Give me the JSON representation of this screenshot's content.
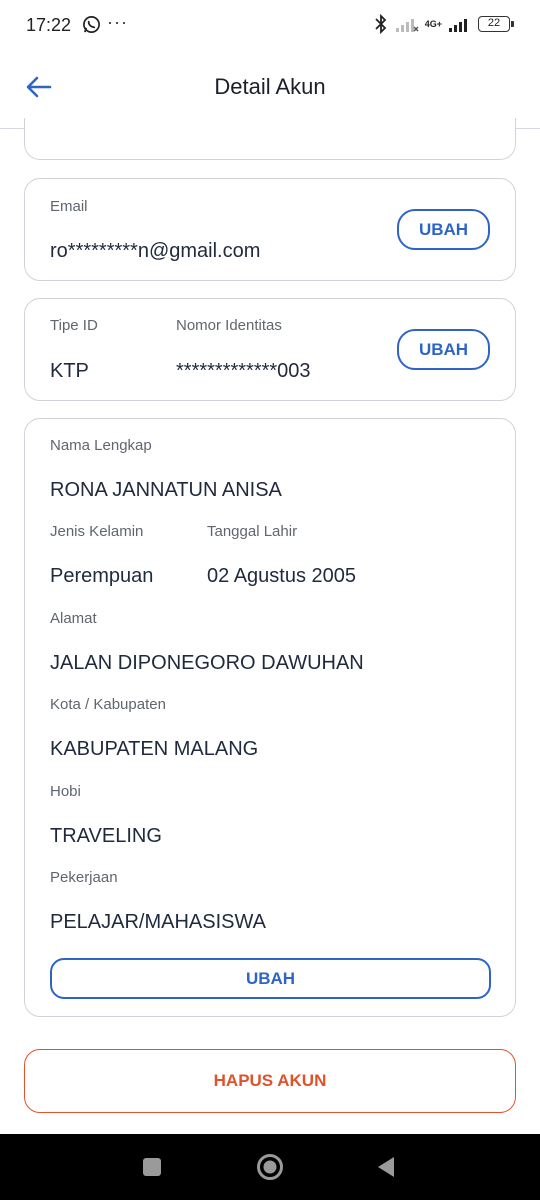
{
  "status_bar": {
    "time": "17:22",
    "dots": "···",
    "network": "4G+",
    "battery": "22",
    "icons": [
      "whatsapp-icon",
      "bluetooth-icon",
      "signal-icon",
      "battery-icon"
    ]
  },
  "app_bar": {
    "title": "Detail Akun",
    "back_icon": "arrow-left-icon"
  },
  "email_card": {
    "label": "Email",
    "value": "ro*********n@gmail.com",
    "button": "UBAH"
  },
  "id_card": {
    "type_label": "Tipe ID",
    "type_value": "KTP",
    "number_label": "Nomor Identitas",
    "number_value": "*************003",
    "button": "UBAH"
  },
  "profile_card": {
    "name_label": "Nama Lengkap",
    "name_value": "RONA JANNATUN ANISA",
    "gender_label": "Jenis Kelamin",
    "gender_value": "Perempuan",
    "birth_label": "Tanggal Lahir",
    "birth_value": "02 Agustus 2005",
    "address_label": "Alamat",
    "address_value": "JALAN DIPONEGORO DAWUHAN",
    "city_label": "Kota / Kabupaten",
    "city_value": "KABUPATEN MALANG",
    "hobby_label": "Hobi",
    "hobby_value": "TRAVELING",
    "job_label": "Pekerjaan",
    "job_value": "PELAJAR/MAHASISWA",
    "button": "UBAH"
  },
  "delete_button": "HAPUS AKUN",
  "colors": {
    "accent": "#2f64c7",
    "danger": "#e0532a",
    "border": "#cfd3d9",
    "text": "#1f2a3d",
    "label": "#5f6670"
  },
  "nav_bar": {
    "icons": [
      "recents-square-icon",
      "home-circle-icon",
      "back-triangle-icon"
    ]
  }
}
